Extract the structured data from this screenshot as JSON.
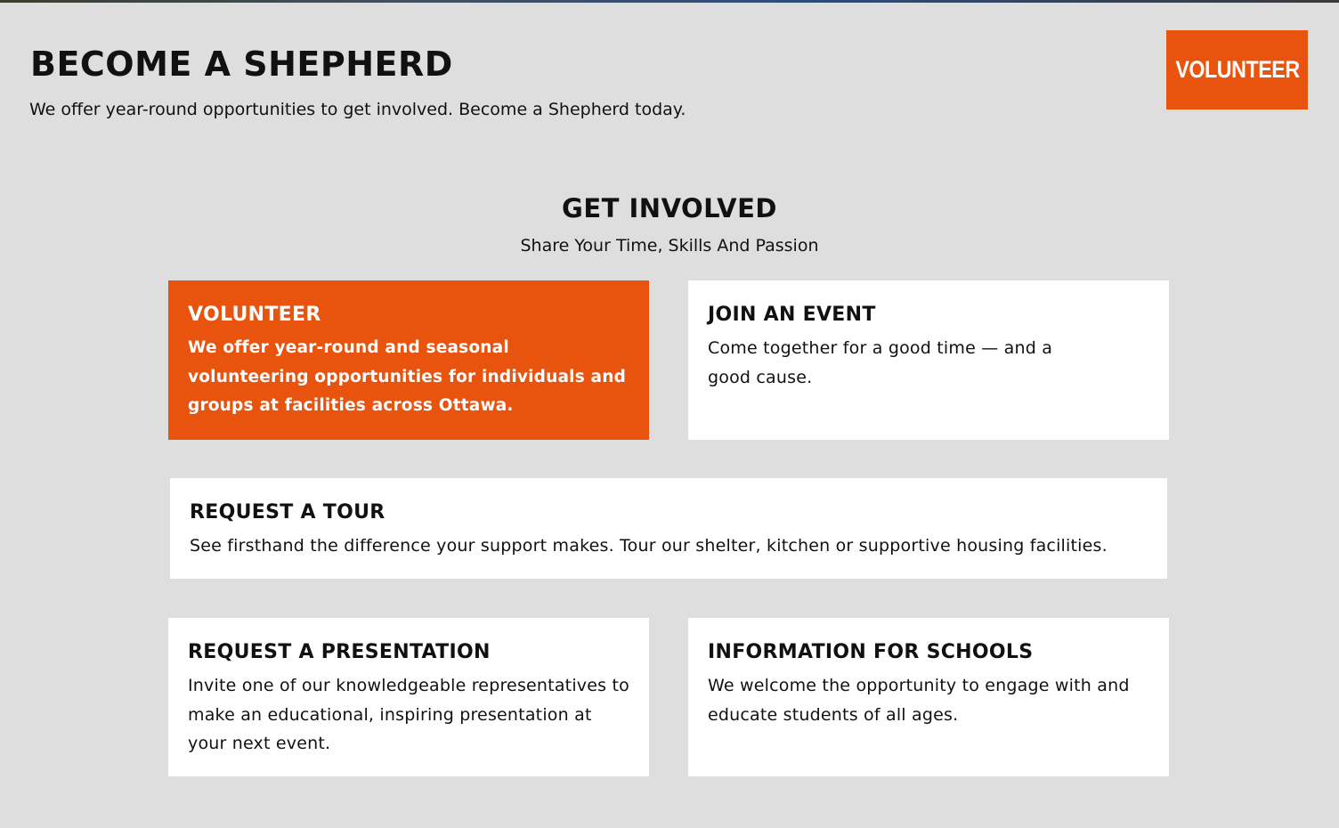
{
  "hero": {
    "title": "BECOME A SHEPHERD",
    "subtitle": "We offer year-round opportunities to get involved. Become a Shepherd today.",
    "cta_label": "VOLUNTEER"
  },
  "section": {
    "title": "GET INVOLVED",
    "subtitle": "Share Your Time, Skills And Passion"
  },
  "cards": [
    {
      "title": "VOLUNTEER",
      "text": "We offer year-round and seasonal volunteering opportunities for individuals and groups at facilities across Ottawa."
    },
    {
      "title": "JOIN AN EVENT",
      "text": "Come together for a good time — and a good cause."
    },
    {
      "title": "REQUEST A TOUR",
      "text": "See firsthand the difference your support makes. Tour our shelter, kitchen or supportive housing facilities."
    },
    {
      "title": "REQUEST A PRESENTATION",
      "text": "Invite one of our knowledgeable representatives to make an educational, inspiring presentation at your next event."
    },
    {
      "title": "INFORMATION FOR SCHOOLS",
      "text": "We welcome the opportunity to engage with and educate students of all ages."
    }
  ],
  "colors": {
    "accent": "#e8530e",
    "background": "#dedede",
    "card": "#ffffff",
    "text": "#111111"
  }
}
